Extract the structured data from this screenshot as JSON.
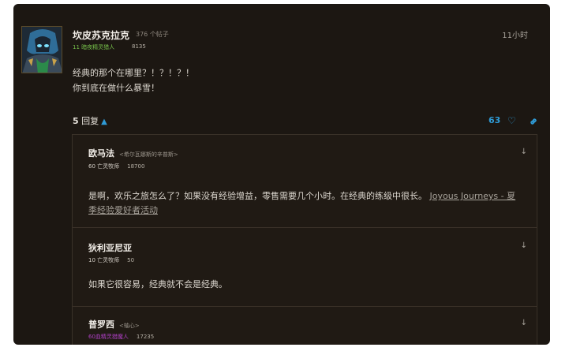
{
  "post": {
    "author": "坎皮苏克拉克",
    "post_count": "376 个帖子",
    "rank": "11 暗夜精灵猎人",
    "score": "8135",
    "time": "11小时",
    "lines": [
      "经典的那个在哪里？！？！？！",
      "你到底在做什么暴雪！"
    ],
    "replies_count": "5",
    "replies_label": "回复",
    "like_count": "63",
    "icons": {
      "avatar": "avatar-image",
      "like": "heart-icon",
      "link": "link-icon",
      "toggle": "chevron-up-icon",
      "jump": "arrow-down-icon"
    },
    "colors": {
      "accent": "#2f9bd6",
      "rank_hunter": "#76c04a",
      "rank_warlock": "#b040c6"
    }
  },
  "replies": [
    {
      "author": "欧马法",
      "title": "<希尔瓦娜斯的辛普斯>",
      "rank": "60 亡灵牧师",
      "score": "18700",
      "text": "是啊，欢乐之旅怎么了？如果没有经验增益，零售需要几个小时。在经典的练级中很长。",
      "link_text": "Joyous Journeys - 夏季经验爱好者活动"
    },
    {
      "author": "狄利亚尼亚",
      "rank": "10 亡灵牧师",
      "score": "50",
      "text": "如果它很容易，经典就不会是经典。"
    },
    {
      "author": "普罗西",
      "title": "<轴心>",
      "rank": "60血精灵猎魔人",
      "score": "17235"
    }
  ]
}
